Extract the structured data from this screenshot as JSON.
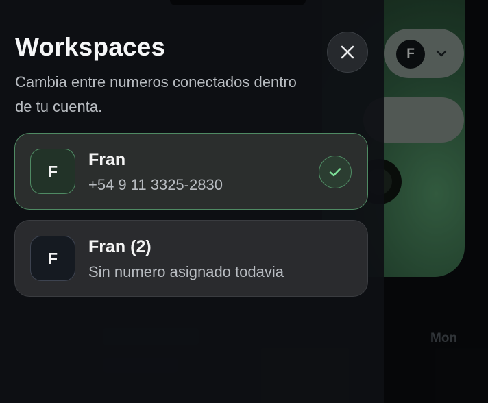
{
  "background": {
    "avatar_letter": "F",
    "row_time": "Mon"
  },
  "sheet": {
    "title": "Workspaces",
    "subtitle": "Cambia entre numeros conectados dentro de tu cuenta.",
    "close_icon": "close-icon",
    "accent_color": "#4f8a63"
  },
  "workspaces": [
    {
      "initial": "F",
      "name": "Fran",
      "subtitle": "+54 9 11 3325-2830",
      "selected": true,
      "status_icon": "check-icon"
    },
    {
      "initial": "F",
      "name": "Fran (2)",
      "subtitle": "Sin numero asignado todavia",
      "selected": false
    }
  ]
}
